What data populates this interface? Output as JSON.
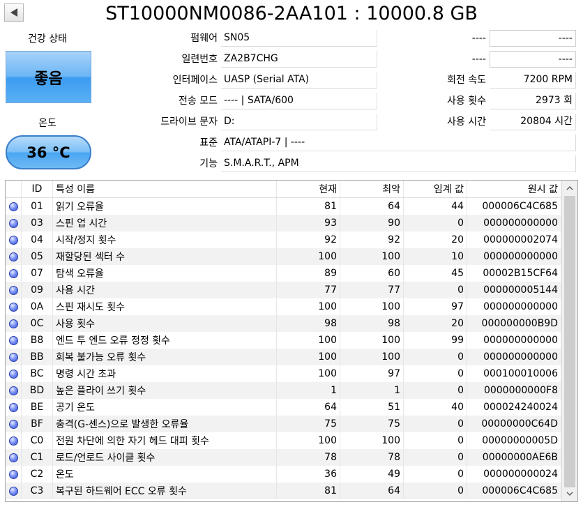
{
  "title": "ST10000NM0086-2AA101 : 10000.8 GB",
  "health": {
    "label": "건강 상태",
    "status": "좋음"
  },
  "temperature": {
    "label": "온도",
    "value": "36 °C"
  },
  "info": {
    "firmware": {
      "label": "펌웨어",
      "value": "SN05"
    },
    "serial": {
      "label": "일련번호",
      "value": "ZA2B7CHG"
    },
    "interface": {
      "label": "인터페이스",
      "value": "UASP (Serial ATA)"
    },
    "transfer_mode": {
      "label": "전송 모드",
      "value": "---- | SATA/600"
    },
    "drive_letter": {
      "label": "드라이브 문자",
      "value": "D:"
    },
    "standard": {
      "label": "표준",
      "value": "ATA/ATAPI-7 | ----"
    },
    "features": {
      "label": "기능",
      "value": "S.M.A.R.T., APM"
    },
    "right1": {
      "label": "----",
      "value": "----"
    },
    "right2": {
      "label": "----",
      "value": "----"
    },
    "rotation": {
      "label": "회전 속도",
      "value": "7200 RPM"
    },
    "power_count": {
      "label": "사용 횟수",
      "value": "2973 회"
    },
    "power_hours": {
      "label": "사용 시간",
      "value": "20804 시간"
    }
  },
  "table": {
    "headers": {
      "id": "ID",
      "name": "특성 이름",
      "current": "현재",
      "worst": "최악",
      "threshold": "임계 값",
      "raw": "원시 값"
    },
    "rows": [
      {
        "id": "01",
        "name": "읽기 오류율",
        "current": "81",
        "worst": "64",
        "threshold": "44",
        "raw": "000006C4C685"
      },
      {
        "id": "03",
        "name": "스핀 업 시간",
        "current": "93",
        "worst": "90",
        "threshold": "0",
        "raw": "000000000000"
      },
      {
        "id": "04",
        "name": "시작/정지 횟수",
        "current": "92",
        "worst": "92",
        "threshold": "20",
        "raw": "000000002074"
      },
      {
        "id": "05",
        "name": "재할당된 섹터 수",
        "current": "100",
        "worst": "100",
        "threshold": "10",
        "raw": "000000000000"
      },
      {
        "id": "07",
        "name": "탐색 오류율",
        "current": "89",
        "worst": "60",
        "threshold": "45",
        "raw": "00002B15CF64"
      },
      {
        "id": "09",
        "name": "사용 시간",
        "current": "77",
        "worst": "77",
        "threshold": "0",
        "raw": "000000005144"
      },
      {
        "id": "0A",
        "name": "스핀 재시도 횟수",
        "current": "100",
        "worst": "100",
        "threshold": "97",
        "raw": "000000000000"
      },
      {
        "id": "0C",
        "name": "사용 횟수",
        "current": "98",
        "worst": "98",
        "threshold": "20",
        "raw": "000000000B9D"
      },
      {
        "id": "B8",
        "name": "엔드 투 엔드 오류 정정 횟수",
        "current": "100",
        "worst": "100",
        "threshold": "99",
        "raw": "000000000000"
      },
      {
        "id": "BB",
        "name": "회복 불가능 오류 횟수",
        "current": "100",
        "worst": "100",
        "threshold": "0",
        "raw": "000000000000"
      },
      {
        "id": "BC",
        "name": "명령 시간 초과",
        "current": "100",
        "worst": "97",
        "threshold": "0",
        "raw": "000100010006"
      },
      {
        "id": "BD",
        "name": "높은 플라이 쓰기 횟수",
        "current": "1",
        "worst": "1",
        "threshold": "0",
        "raw": "0000000000F8"
      },
      {
        "id": "BE",
        "name": "공기 온도",
        "current": "64",
        "worst": "51",
        "threshold": "40",
        "raw": "000024240024"
      },
      {
        "id": "BF",
        "name": "충격(G-센스)으로 발생한 오류율",
        "current": "75",
        "worst": "75",
        "threshold": "0",
        "raw": "00000000C64D"
      },
      {
        "id": "C0",
        "name": "전원 차단에 의한 자기 헤드 대피 횟수",
        "current": "100",
        "worst": "100",
        "threshold": "0",
        "raw": "00000000005D"
      },
      {
        "id": "C1",
        "name": "로드/언로드 사이클 횟수",
        "current": "78",
        "worst": "78",
        "threshold": "0",
        "raw": "00000000AE6B"
      },
      {
        "id": "C2",
        "name": "온도",
        "current": "36",
        "worst": "49",
        "threshold": "0",
        "raw": "000000000024"
      },
      {
        "id": "C3",
        "name": "복구된 하드웨어 ECC 오류 횟수",
        "current": "81",
        "worst": "64",
        "threshold": "0",
        "raw": "000006C4C685"
      }
    ]
  },
  "status_icon": "blue-circle-icon",
  "colors": {
    "health_good": "#3d9cf0",
    "status_dot": "#3550d8"
  }
}
